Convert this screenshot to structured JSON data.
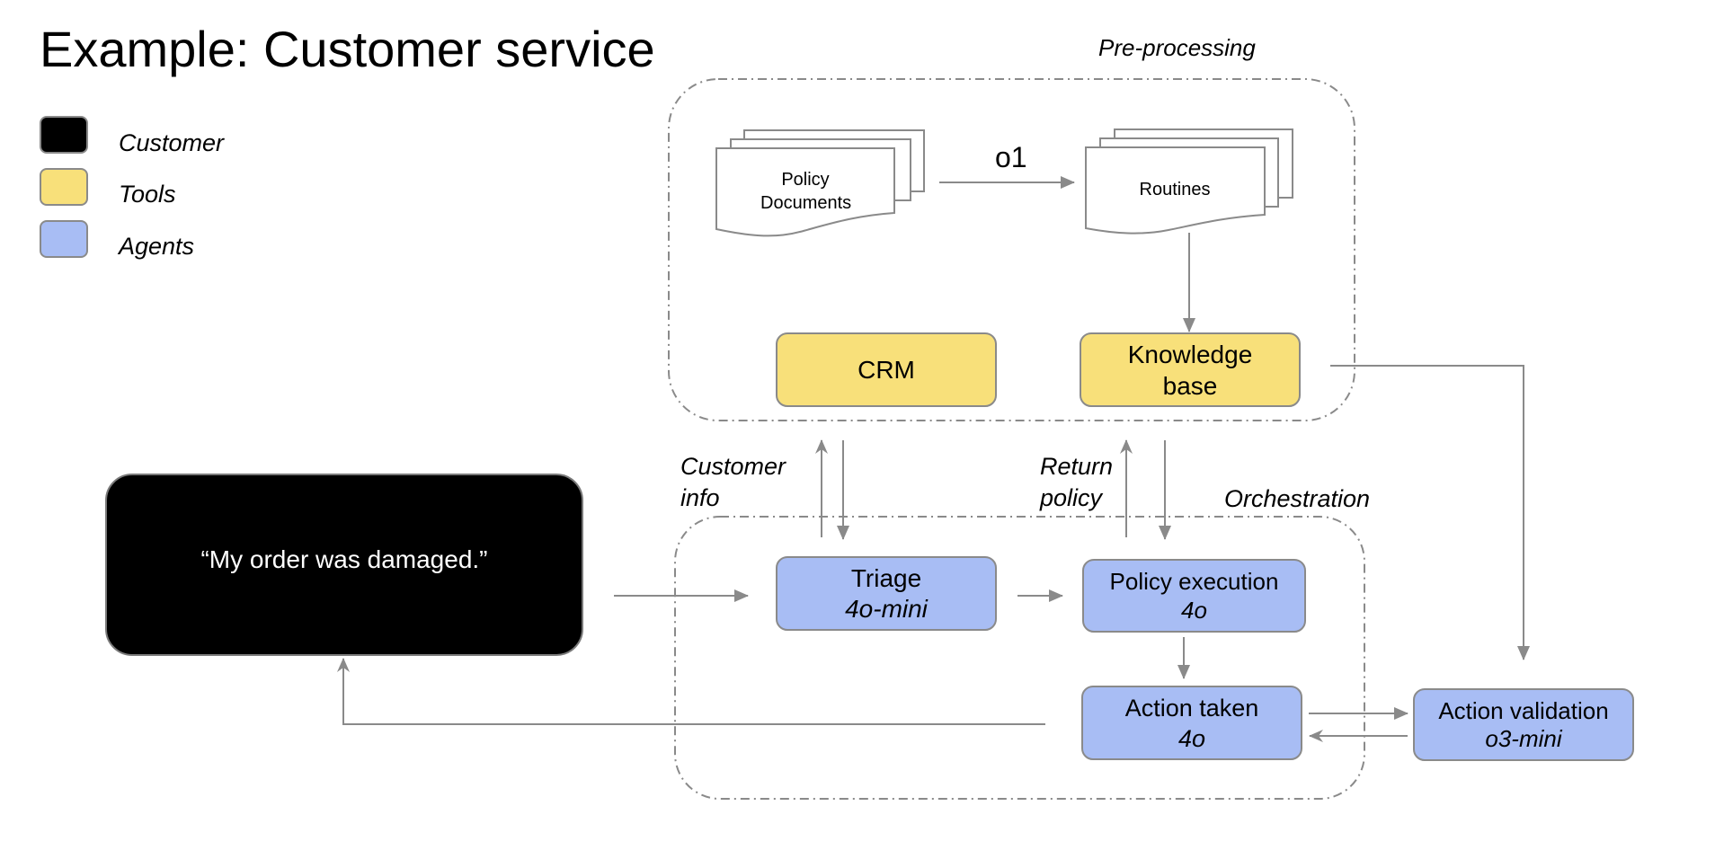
{
  "title": "Example: Customer service",
  "legend": [
    {
      "label": "Customer",
      "color": "#000000"
    },
    {
      "label": "Tools",
      "color": "#f8e07a"
    },
    {
      "label": "Agents",
      "color": "#a8bdf4"
    }
  ],
  "groups": {
    "preprocessing": "Pre-processing",
    "orchestration": "Orchestration"
  },
  "documents": {
    "policy": [
      "Policy",
      "Documents"
    ],
    "routines": [
      "Routines"
    ],
    "transform_model": "o1"
  },
  "tools": {
    "crm": "CRM",
    "knowledge_base": [
      "Knowledge",
      "base"
    ]
  },
  "customer": {
    "message": "“My order was damaged.”"
  },
  "agents": {
    "triage": {
      "name": "Triage",
      "model": "4o-mini"
    },
    "policy_execution": {
      "name": "Policy execution",
      "model": "4o"
    },
    "action_taken": {
      "name": "Action taken",
      "model": "4o"
    },
    "action_validation": {
      "name": "Action validation",
      "model": "o3-mini"
    }
  },
  "flow_labels": {
    "customer_info": [
      "Customer",
      "info"
    ],
    "return_policy": [
      "Return",
      "policy"
    ]
  },
  "colors": {
    "tool": "#f8e07a",
    "agent": "#a8bdf4",
    "customer": "#000000",
    "stroke": "#8a8a8a"
  }
}
